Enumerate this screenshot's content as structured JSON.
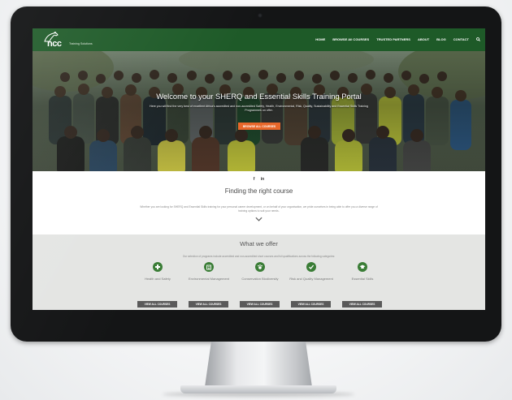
{
  "nav": {
    "logo_text": "ncc",
    "logo_sub": "Training Solutions",
    "links": [
      "HOME",
      "BROWSE All COURSES",
      "TRUSTED PARTNERS",
      "ABOUT",
      "BLOG",
      "CONTACT"
    ]
  },
  "hero": {
    "title": "Welcome to your SHERQ and Essential Skills Training Portal",
    "subtitle": "Here you will find the very best of excellent Africa's accredited and non-accredited Safety, Health, Environmental, Risk, Quality, Sustainability and Essential Skills Training Programmes on offer.",
    "button_label": "BROWSE ALL COURSES"
  },
  "social": {
    "facebook": "f",
    "linkedin": "in"
  },
  "finding": {
    "title": "Finding the right course",
    "description": "Whether you are looking for SHERQ and Essential Skills training for your personal career development, or on behalf of your organisation, we pride ourselves in being able to offer you a diverse range of training options to suit your needs."
  },
  "offer": {
    "title": "What we offer",
    "description": "Our selection of programs include accredited and non-accredited short courses and full qualifications across the following categories:",
    "services": [
      {
        "label": "Health and Safety",
        "icon": "plus-icon",
        "button": "VIEW ALL COURSES"
      },
      {
        "label": "Environmental Management",
        "icon": "building-icon",
        "button": "VIEW ALL COURSES"
      },
      {
        "label": "Conservation Biodiversity",
        "icon": "paw-icon",
        "button": "VIEW ALL COURSES"
      },
      {
        "label": "Risk and Quality Management",
        "icon": "check-icon",
        "button": "VIEW ALL COURSES"
      },
      {
        "label": "Essential Skills",
        "icon": "graduation-cap-icon",
        "button": "VIEW ALL COURSES"
      }
    ]
  },
  "colors": {
    "nav_green": "#1e5a28",
    "accent_orange": "#e8672a",
    "icon_green": "#3a7d36",
    "button_grey": "#5a5a5a"
  }
}
